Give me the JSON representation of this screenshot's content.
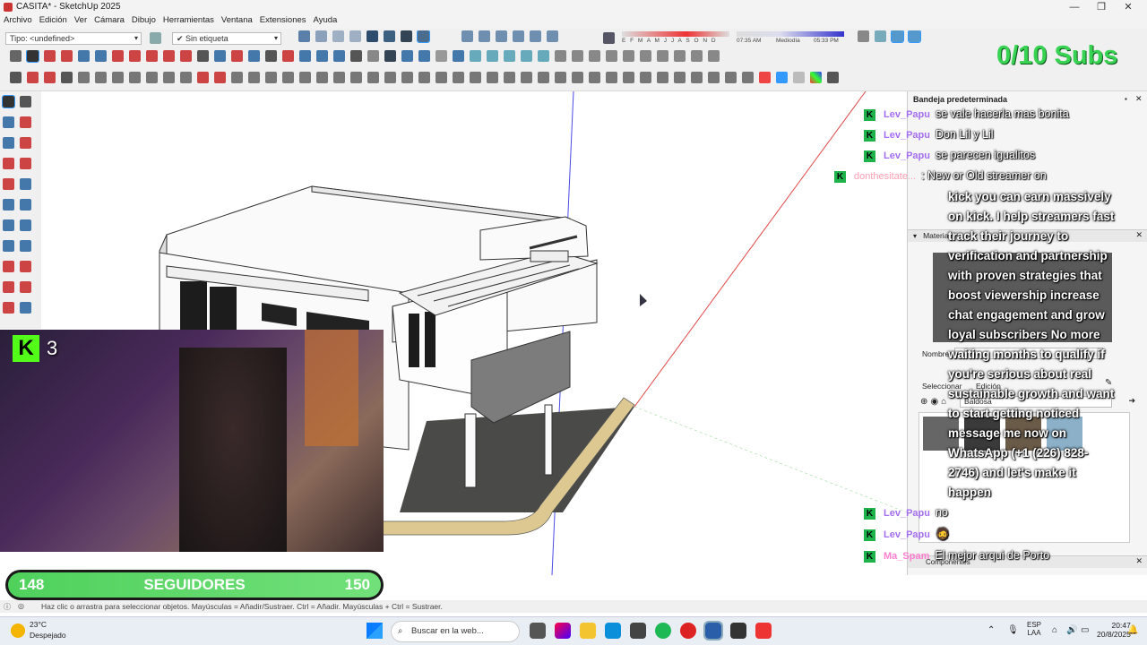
{
  "window": {
    "title": "CASITA* - SketchUp 2025",
    "controls": [
      "—",
      "❐",
      "✕"
    ]
  },
  "menu": [
    "Archivo",
    "Edición",
    "Ver",
    "Cámara",
    "Dibujo",
    "Herramientas",
    "Ventana",
    "Extensiones",
    "Ayuda"
  ],
  "toolbar": {
    "type_combo": "Tipo: <undefined>",
    "tag_combo": "Sin etiqueta",
    "shadow_months": "E F M A M J J A S O N D",
    "time_start": "07:35 AM",
    "time_mid": "Mediodía",
    "time_end": "05:33 PM"
  },
  "overlay": {
    "subs_counter": "0/10 Subs",
    "kick_viewers": "3",
    "followers_current": "148",
    "followers_label": "SEGUIDORES",
    "followers_goal": "150",
    "follow_progress": 0.986
  },
  "panel": {
    "tray_title": "Bandeja predeterminada",
    "materials_title": "Materia",
    "name_label": "Nombre",
    "tab_select": "Seleccionar",
    "tab_edit": "Edición",
    "material_dropdown": "Baldosa",
    "components_title": "Componentes"
  },
  "chat": [
    {
      "user": "Lev_Papu",
      "text": "se vale hacerla mas bonita",
      "color": "#a46ef0"
    },
    {
      "user": "Lev_Papu",
      "text": "Don Lil y Lil",
      "color": "#a46ef0"
    },
    {
      "user": "Lev_Papu",
      "text": "se parecen igualitos",
      "color": "#a46ef0"
    },
    {
      "user": "donthesitate...",
      "text": ": New or Old streamer on",
      "color": "#ff9fb3"
    }
  ],
  "promo_lines": [
    "kick you can earn massively",
    "on kick. I help streamers fast",
    "track their journey to",
    "verification and partnership",
    "with proven strategies that",
    "boost viewership increase",
    "chat engagement and grow",
    "loyal subscribers No more",
    "waiting months to qualify if",
    "you're serious about real",
    "sustainable growth and want",
    "to start getting noticed",
    "message me now on",
    "WhatsApp (+1 (226) 828-",
    "2746) and let's make it",
    "happen"
  ],
  "chat_bottom": [
    {
      "user": "Lev_Papu",
      "text": "no",
      "color": "#a46ef0"
    },
    {
      "user": "Lev_Papu",
      "text": "🧔",
      "color": "#a46ef0"
    },
    {
      "user": "Ma_Spam",
      "text": "El mejor arqui de Porto",
      "color": "#ff7fd0"
    }
  ],
  "status": {
    "hint": "Haz clic o arrastra para seleccionar objetos. Mayúsculas = Añadir/Sustraer. Ctrl = Añadir. Mayúsculas + Ctrl = Sustraer."
  },
  "taskbar": {
    "weather_temp": "23°C",
    "weather_desc": "Despejado",
    "search_placeholder": "Buscar en la web...",
    "lang_top": "ESP",
    "lang_bottom": "LAA",
    "clock_time": "20:47",
    "clock_date": "20/8/2025"
  },
  "colors": {
    "kick_green": "#53fc18",
    "subs_green": "#39d353"
  }
}
